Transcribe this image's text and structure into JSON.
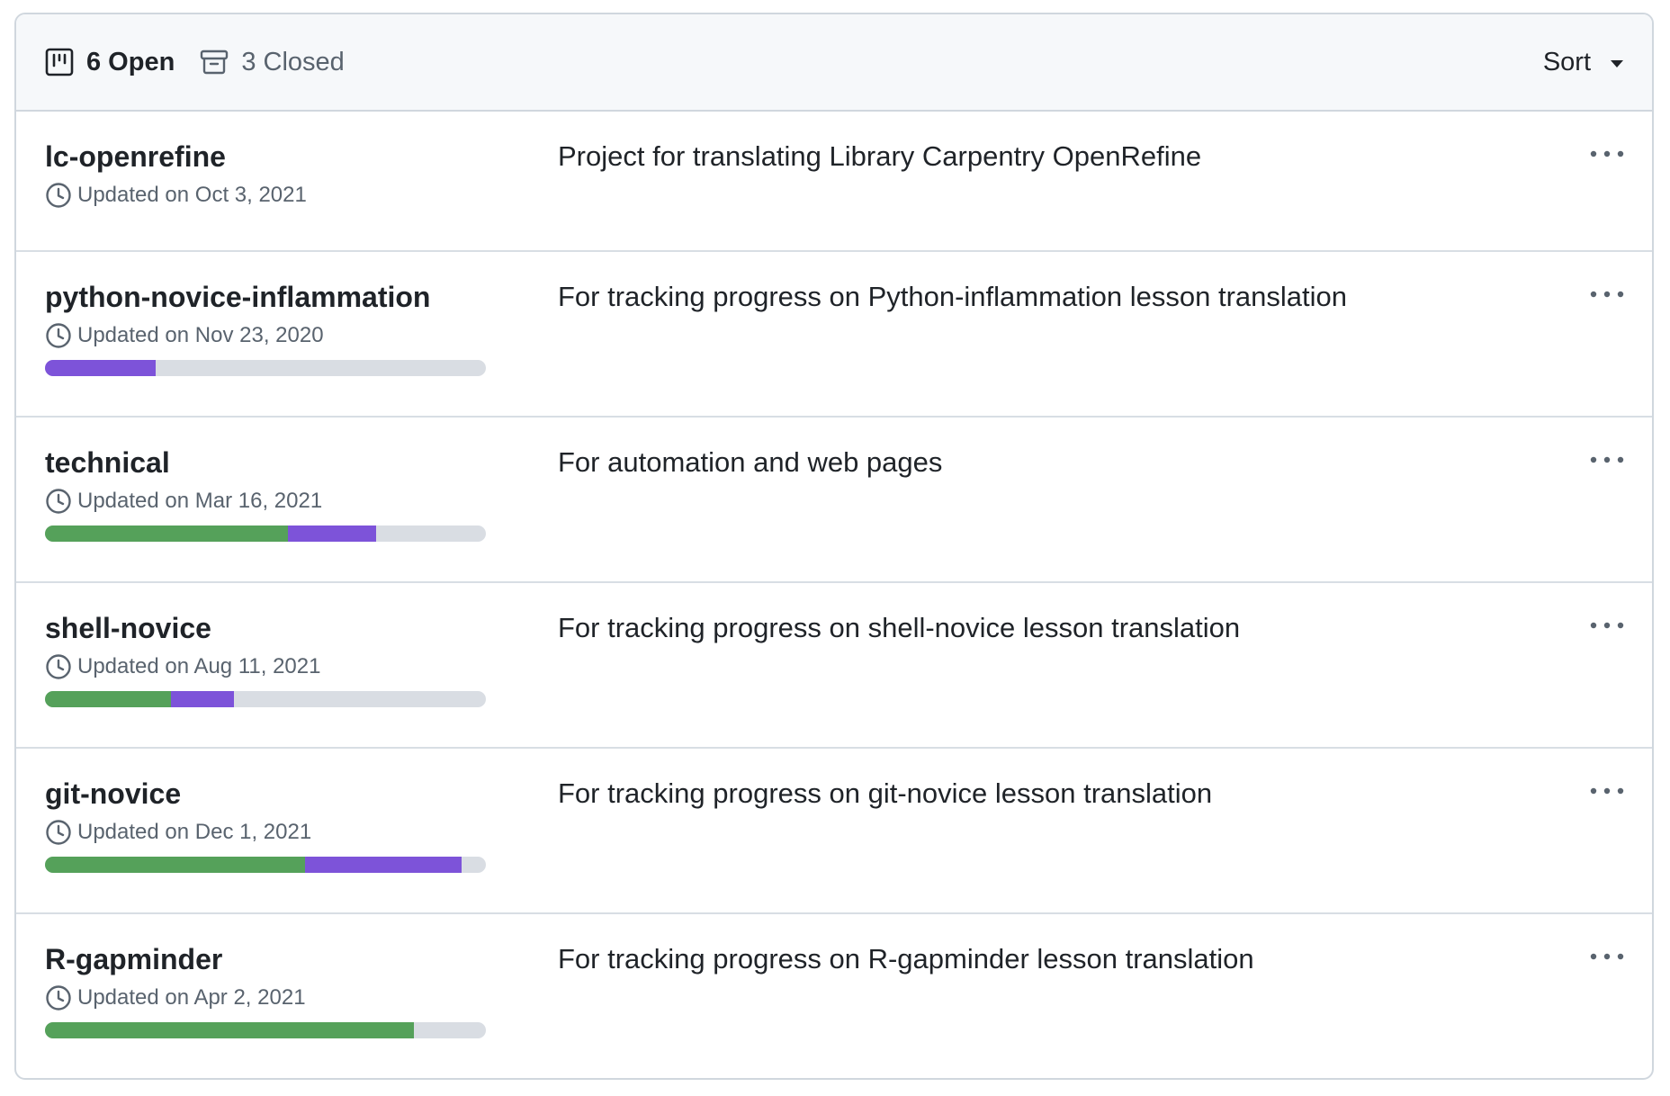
{
  "header": {
    "open_label": "6 Open",
    "closed_label": "3 Closed",
    "sort_label": "Sort",
    "open_icon": "project-board-icon",
    "closed_icon": "archive-box-icon"
  },
  "colors": {
    "done": "#55a15a",
    "in_progress": "#7d53d9",
    "todo": "#d9dde3"
  },
  "projects": [
    {
      "name": "lc-openrefine",
      "updated": "Updated on Oct 3, 2021",
      "description": "Project for translating Library Carpentry OpenRefine",
      "progress": null
    },
    {
      "name": "python-novice-inflammation",
      "updated": "Updated on Nov 23, 2020",
      "description": "For tracking progress on Python-inflammation lesson translation",
      "progress": {
        "done": 0,
        "in_progress": 0.25
      }
    },
    {
      "name": "technical",
      "updated": "Updated on Mar 16, 2021",
      "description": "For automation and web pages",
      "progress": {
        "done": 0.55,
        "in_progress": 0.2
      }
    },
    {
      "name": "shell-novice",
      "updated": "Updated on Aug 11, 2021",
      "description": "For tracking progress on shell-novice lesson translation",
      "progress": {
        "done": 0.286,
        "in_progress": 0.143
      }
    },
    {
      "name": "git-novice",
      "updated": "Updated on Dec 1, 2021",
      "description": "For tracking progress on git-novice lesson translation",
      "progress": {
        "done": 0.59,
        "in_progress": 0.355
      }
    },
    {
      "name": "R-gapminder",
      "updated": "Updated on Apr 2, 2021",
      "description": "For tracking progress on R-gapminder lesson translation",
      "progress": {
        "done": 0.836,
        "in_progress": 0
      }
    }
  ]
}
